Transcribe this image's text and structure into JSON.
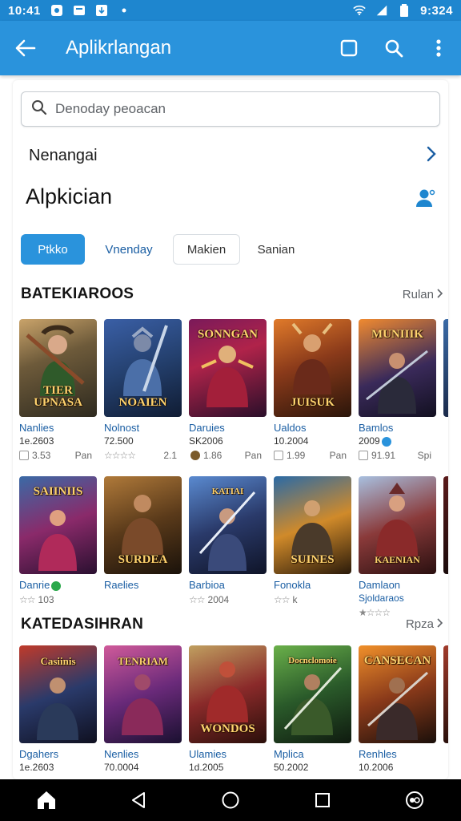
{
  "status_bar": {
    "time_left": "10:41",
    "time_right": "9:324"
  },
  "app_bar": {
    "title": "Aplikrlangan"
  },
  "search": {
    "placeholder": "Denoday peoacan"
  },
  "nav_row": {
    "label": "Nenangai"
  },
  "page_title": "Alpkician",
  "chips": [
    "Ptkko",
    "Vnenday",
    "Makien",
    "Sanian"
  ],
  "sections": [
    {
      "title": "BATEKIAROOS",
      "more": "Rulan",
      "rows": [
        [
          {
            "art": "TIER UPNASA",
            "name": "Nanlies",
            "sub": "1e.2603",
            "rating": "3.53",
            "extra": "Pan",
            "meta": "box"
          },
          {
            "art": "NOAIEN",
            "name": "Nolnost",
            "sub": "72.500",
            "rating": "2.1",
            "extra": "",
            "meta": "stars"
          },
          {
            "art": "SONNGAN",
            "name": "Daruies",
            "sub": "SK2006",
            "rating": "1.86",
            "extra": "Pan",
            "meta": "coin"
          },
          {
            "art": "JUISUK",
            "name": "Ualdos",
            "sub": "10.2004",
            "rating": "1.99",
            "extra": "Pan",
            "meta": "box"
          },
          {
            "art": "MUNIIIK",
            "name": "Bamlos",
            "sub": "2009",
            "rating": "91.91",
            "extra": "Spi",
            "meta": "box"
          }
        ],
        [
          {
            "art": "SAIINIIS",
            "name": "Danrie",
            "sub": "",
            "rating": "103",
            "extra": "",
            "meta": "stars"
          },
          {
            "art": "SURDEA",
            "name": "Raelies",
            "sub": "",
            "rating": "",
            "extra": "",
            "meta": "none"
          },
          {
            "art": "KATIAI",
            "name": "Barbioa",
            "sub": "",
            "rating": "2004",
            "extra": "",
            "meta": "stars"
          },
          {
            "art": "SUINES",
            "name": "Fonokla",
            "sub": "",
            "rating": "k",
            "extra": "",
            "meta": "stars"
          },
          {
            "art": "KAENIAN",
            "name": "Damlaon",
            "sub": "Sjoldaraos",
            "rating": "",
            "extra": "",
            "meta": "stars"
          }
        ]
      ]
    },
    {
      "title": "KATEDASIHRAN",
      "more": "Rpza",
      "rows": [
        [
          {
            "art": "Casiinis",
            "name": "Dgahers",
            "sub": "1e.2603",
            "rating": "",
            "extra": "",
            "meta": "none"
          },
          {
            "art": "TENRIAM",
            "name": "Nenlies",
            "sub": "70.0004",
            "rating": "",
            "extra": "",
            "meta": "none"
          },
          {
            "art": "WONDOS",
            "name": "Ulamies",
            "sub": "1d.2005",
            "rating": "",
            "extra": "",
            "meta": "none"
          },
          {
            "art": "Docnclomoie",
            "name": "Mplica",
            "sub": "50.2002",
            "rating": "",
            "extra": "",
            "meta": "none"
          },
          {
            "art": "CANSECAN",
            "name": "Renhles",
            "sub": "10.2006",
            "rating": "",
            "extra": "",
            "meta": "none"
          }
        ]
      ]
    }
  ],
  "colors": {
    "status_bar": "#1e86cf",
    "app_bar": "#2a93dc",
    "accent": "#2a93dc",
    "link": "#1a5ea3"
  },
  "icons": [
    "back-arrow-icon",
    "square-icon",
    "search-icon",
    "more-vert-icon",
    "chevron-right-icon",
    "person-icon",
    "home-icon",
    "back-triangle-icon",
    "circle-home-icon",
    "recent-square-icon",
    "assistant-icon"
  ]
}
